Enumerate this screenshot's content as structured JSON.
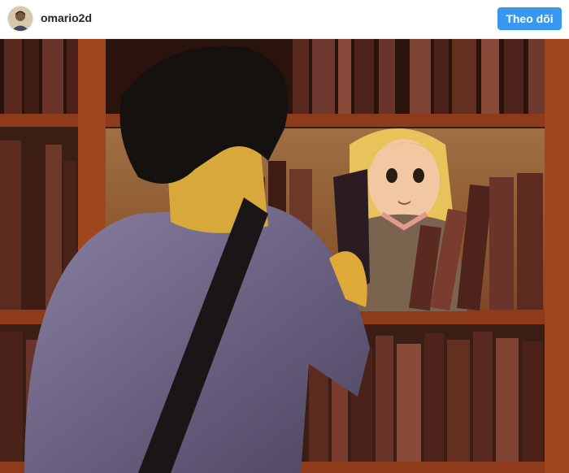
{
  "post": {
    "username": "omario2d",
    "follow_label": "Theo dõi",
    "avatar_icon": "user-avatar-photo",
    "image_subject": "illustration-library-bookshelf"
  },
  "colors": {
    "follow_button": "#3897f0",
    "username": "#262626"
  }
}
